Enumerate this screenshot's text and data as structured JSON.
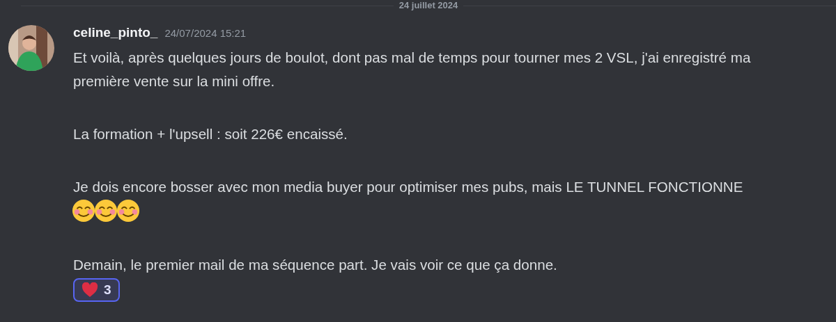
{
  "date_divider": {
    "label": "24 juillet 2024"
  },
  "message": {
    "author": "celine_pinto_",
    "timestamp": "24/07/2024 15:21",
    "paragraphs": [
      {
        "text": "Et voilà, après quelques jours de boulot, dont pas mal de temps pour tourner mes 2 VSL, j'ai enregistré ma première vente sur la mini offre."
      },
      {
        "text": "La formation + l'upsell : soit 226€ encaissé."
      },
      {
        "text": "Je dois encore bosser avec mon media buyer pour optimiser mes pubs,  mais LE TUNNEL FONCTIONNE",
        "emojis": [
          {
            "kind": "smiling-face"
          },
          {
            "kind": "smiling-face"
          },
          {
            "kind": "smiling-face"
          }
        ]
      },
      {
        "text": "Demain, le premier mail de ma séquence part. Je vais voir ce que ça donne."
      }
    ],
    "reactions": [
      {
        "count": "3",
        "selected": true
      }
    ]
  }
}
